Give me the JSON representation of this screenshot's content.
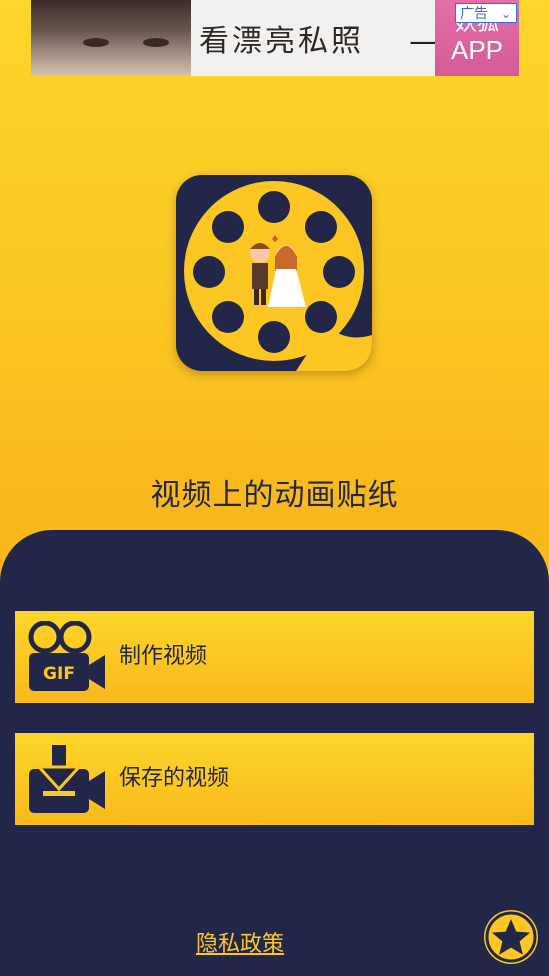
{
  "ad": {
    "text": "看漂亮私照",
    "brand_text": "妖狐",
    "app_text": "APP",
    "tag_label": "广告"
  },
  "app": {
    "title": "视频上的动画贴纸"
  },
  "menu": {
    "make_video": "制作视频",
    "saved_videos": "保存的视频",
    "gif_label": "GIF"
  },
  "footer": {
    "privacy_policy": "隐私政策"
  },
  "colors": {
    "accent_yellow": "#fcc722",
    "navy": "#22274a",
    "ad_tag_blue": "#3a6fd8"
  },
  "icons": {
    "make_video": "gif-camera-icon",
    "saved_videos": "download-camera-icon",
    "rate": "star-icon",
    "ad_dropdown": "chevron-down-icon"
  }
}
